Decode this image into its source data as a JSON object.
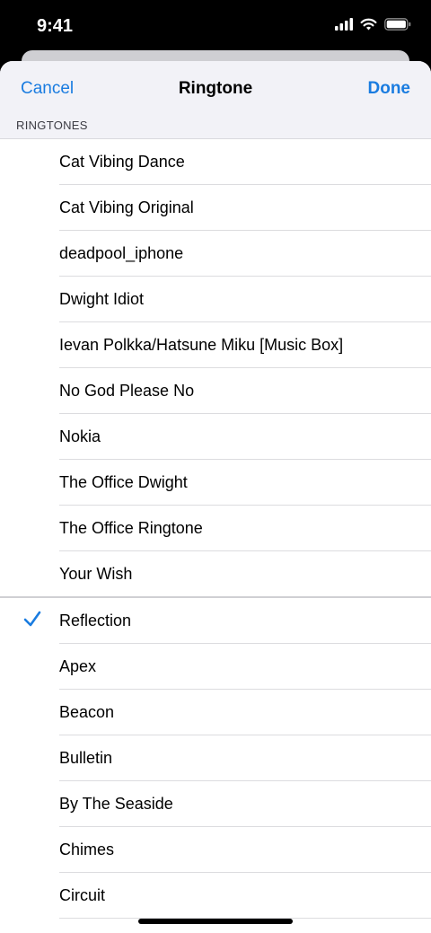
{
  "status": {
    "time": "9:41"
  },
  "nav": {
    "cancel": "Cancel",
    "title": "Ringtone",
    "done": "Done"
  },
  "section": {
    "header": "RINGTONES"
  },
  "custom_ringtones": [
    "Cat Vibing Dance",
    "Cat Vibing Original",
    "deadpool_iphone",
    "Dwight Idiot",
    "Ievan Polkka/Hatsune Miku [Music Box]",
    "No God Please No",
    "Nokia",
    "The Office Dwight",
    "The Office Ringtone",
    "Your Wish"
  ],
  "builtin_ringtones": [
    "Reflection",
    "Apex",
    "Beacon",
    "Bulletin",
    "By The Seaside",
    "Chimes",
    "Circuit"
  ],
  "selected": "Reflection",
  "colors": {
    "accent": "#1a7ce0"
  }
}
